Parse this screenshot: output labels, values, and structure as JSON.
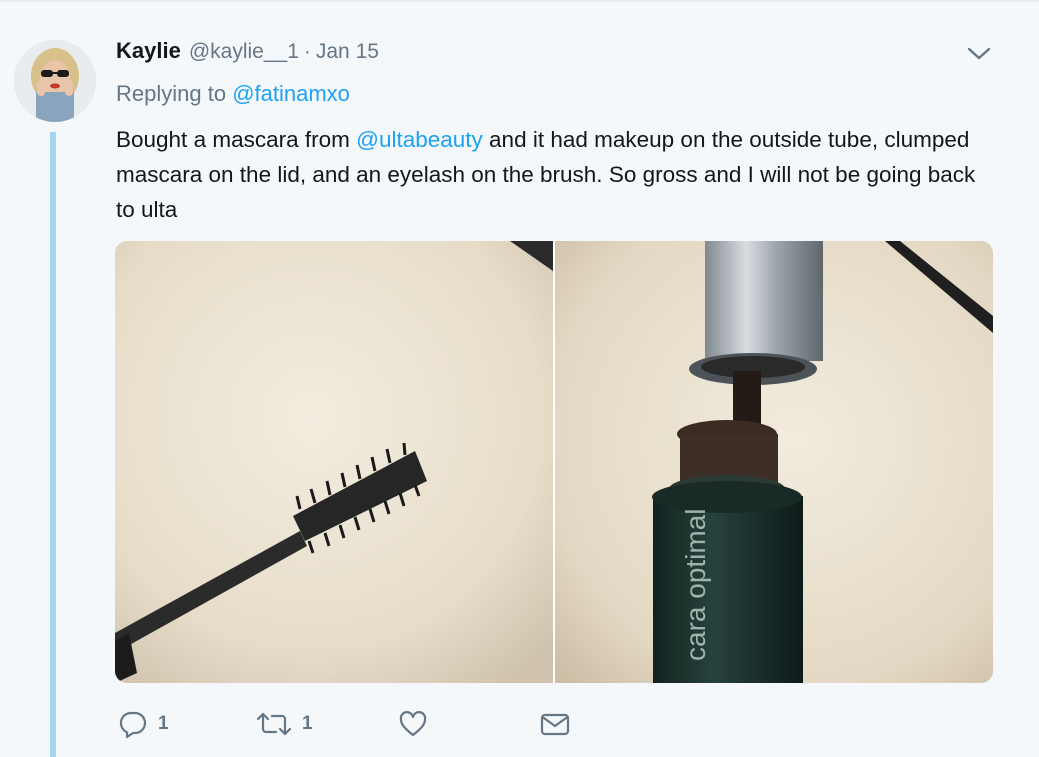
{
  "tweet": {
    "author_name": "Kaylie",
    "author_handle": "@kaylie__1",
    "separator": "·",
    "timestamp": "Jan 15",
    "replying_prefix": "Replying to",
    "replying_to": "@fatinamxo",
    "text_part1": "Bought a mascara from ",
    "mention": "@ultabeauty",
    "text_part2": " and it had makeup on the outside tube, clumped mascara on the lid, and an eyelash on the brush. So gross and I will not be going back to ulta",
    "photo2_label": "cara optimal"
  },
  "actions": {
    "reply_count": "1",
    "retweet_count": "1"
  },
  "colors": {
    "link": "#1da1f2",
    "muted": "#657786",
    "thread_line": "#a8d4f4",
    "background": "#f5f8fa"
  },
  "icons": [
    "chevron-down-icon",
    "reply-icon",
    "retweet-icon",
    "like-icon",
    "direct-message-icon"
  ]
}
